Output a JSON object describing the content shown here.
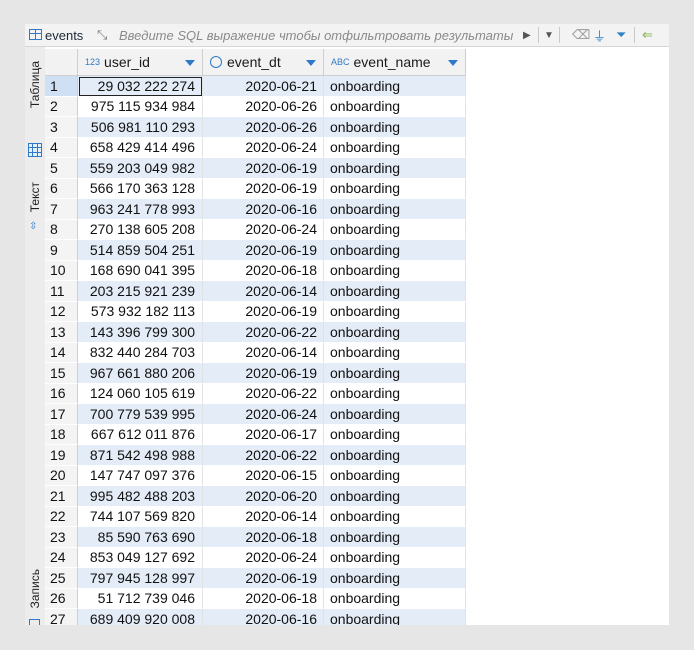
{
  "toolbar": {
    "title": "events",
    "filter_placeholder": "Введите SQL выражение чтобы отфильтровать результаты"
  },
  "sidebar": {
    "tab_table": "Таблица",
    "tab_text": "Текст",
    "tab_record": "Запись"
  },
  "columns": {
    "user_id": {
      "type_badge": "123",
      "label": "user_id"
    },
    "event_dt": {
      "label": "event_dt"
    },
    "event_name": {
      "type_badge": "ABC",
      "label": "event_name"
    }
  },
  "rows": [
    {
      "n": "1",
      "user_id": "29 032 222 274",
      "event_dt": "2020-06-21",
      "event_name": "onboarding"
    },
    {
      "n": "2",
      "user_id": "975 115 934 984",
      "event_dt": "2020-06-26",
      "event_name": "onboarding"
    },
    {
      "n": "3",
      "user_id": "506 981 110 293",
      "event_dt": "2020-06-26",
      "event_name": "onboarding"
    },
    {
      "n": "4",
      "user_id": "658 429 414 496",
      "event_dt": "2020-06-24",
      "event_name": "onboarding"
    },
    {
      "n": "5",
      "user_id": "559 203 049 982",
      "event_dt": "2020-06-19",
      "event_name": "onboarding"
    },
    {
      "n": "6",
      "user_id": "566 170 363 128",
      "event_dt": "2020-06-19",
      "event_name": "onboarding"
    },
    {
      "n": "7",
      "user_id": "963 241 778 993",
      "event_dt": "2020-06-16",
      "event_name": "onboarding"
    },
    {
      "n": "8",
      "user_id": "270 138 605 208",
      "event_dt": "2020-06-24",
      "event_name": "onboarding"
    },
    {
      "n": "9",
      "user_id": "514 859 504 251",
      "event_dt": "2020-06-19",
      "event_name": "onboarding"
    },
    {
      "n": "10",
      "user_id": "168 690 041 395",
      "event_dt": "2020-06-18",
      "event_name": "onboarding"
    },
    {
      "n": "11",
      "user_id": "203 215 921 239",
      "event_dt": "2020-06-14",
      "event_name": "onboarding"
    },
    {
      "n": "12",
      "user_id": "573 932 182 113",
      "event_dt": "2020-06-19",
      "event_name": "onboarding"
    },
    {
      "n": "13",
      "user_id": "143 396 799 300",
      "event_dt": "2020-06-22",
      "event_name": "onboarding"
    },
    {
      "n": "14",
      "user_id": "832 440 284 703",
      "event_dt": "2020-06-14",
      "event_name": "onboarding"
    },
    {
      "n": "15",
      "user_id": "967 661 880 206",
      "event_dt": "2020-06-19",
      "event_name": "onboarding"
    },
    {
      "n": "16",
      "user_id": "124 060 105 619",
      "event_dt": "2020-06-22",
      "event_name": "onboarding"
    },
    {
      "n": "17",
      "user_id": "700 779 539 995",
      "event_dt": "2020-06-24",
      "event_name": "onboarding"
    },
    {
      "n": "18",
      "user_id": "667 612 011 876",
      "event_dt": "2020-06-17",
      "event_name": "onboarding"
    },
    {
      "n": "19",
      "user_id": "871 542 498 988",
      "event_dt": "2020-06-22",
      "event_name": "onboarding"
    },
    {
      "n": "20",
      "user_id": "147 747 097 376",
      "event_dt": "2020-06-15",
      "event_name": "onboarding"
    },
    {
      "n": "21",
      "user_id": "995 482 488 203",
      "event_dt": "2020-06-20",
      "event_name": "onboarding"
    },
    {
      "n": "22",
      "user_id": "744 107 569 820",
      "event_dt": "2020-06-14",
      "event_name": "onboarding"
    },
    {
      "n": "23",
      "user_id": "85 590 763 690",
      "event_dt": "2020-06-18",
      "event_name": "onboarding"
    },
    {
      "n": "24",
      "user_id": "853 049 127 692",
      "event_dt": "2020-06-24",
      "event_name": "onboarding"
    },
    {
      "n": "25",
      "user_id": "797 945 128 997",
      "event_dt": "2020-06-19",
      "event_name": "onboarding"
    },
    {
      "n": "26",
      "user_id": "51 712 739 046",
      "event_dt": "2020-06-18",
      "event_name": "onboarding"
    },
    {
      "n": "27",
      "user_id": "689 409 920 008",
      "event_dt": "2020-06-16",
      "event_name": "onboarding"
    }
  ],
  "selected_row": "1",
  "colors": {
    "accent": "#2f7ac8",
    "row_stripe": "#e4ecf7",
    "funnel": "#2c82c9",
    "back_arrow": "#7cb342"
  }
}
